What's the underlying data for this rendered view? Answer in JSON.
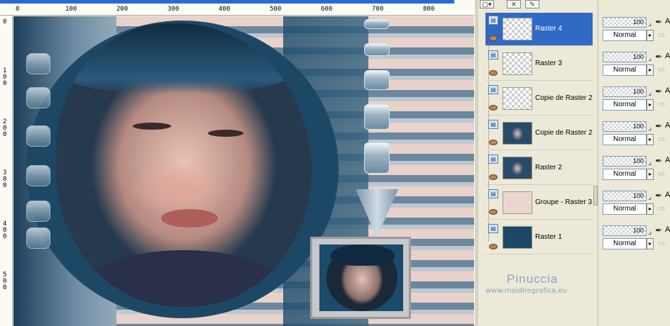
{
  "rulers": {
    "top_ticks": [
      "100",
      "200",
      "300",
      "400",
      "500",
      "600",
      "700",
      "800"
    ],
    "left_ticks": [
      "0",
      "1 0 0",
      "2 0 0",
      "3 0 0",
      "4 0 0",
      "5 0 0"
    ]
  },
  "layers": [
    {
      "name": "Raster 4",
      "selected": true,
      "thumb": "transparent"
    },
    {
      "name": "Raster 3",
      "selected": false,
      "thumb": "transparent"
    },
    {
      "name": "Copie de Raster 2",
      "selected": false,
      "thumb": "transparent"
    },
    {
      "name": "Copie de Raster 2",
      "selected": false,
      "thumb": "portrait"
    },
    {
      "name": "Raster 2",
      "selected": false,
      "thumb": "portrait"
    },
    {
      "name": "Groupe - Raster 3",
      "selected": false,
      "thumb": "pink"
    },
    {
      "name": "Raster 1",
      "selected": false,
      "thumb": "navy"
    }
  ],
  "props": [
    {
      "opacity": "100",
      "blend": "Normal"
    },
    {
      "opacity": "100",
      "blend": "Normal"
    },
    {
      "opacity": "100",
      "blend": "Normal"
    },
    {
      "opacity": "100",
      "blend": "Normal"
    },
    {
      "opacity": "100",
      "blend": "Normal"
    },
    {
      "opacity": "100",
      "blend": "Normal"
    },
    {
      "opacity": "100",
      "blend": "Normal"
    }
  ],
  "props_label": "A",
  "watermark": {
    "title": "Pinuccia",
    "url": "www.maidiregrafica.eu"
  },
  "colors": {
    "accent": "#316ac5",
    "navy": "#1c4866",
    "pink": "#ecd6d2"
  }
}
